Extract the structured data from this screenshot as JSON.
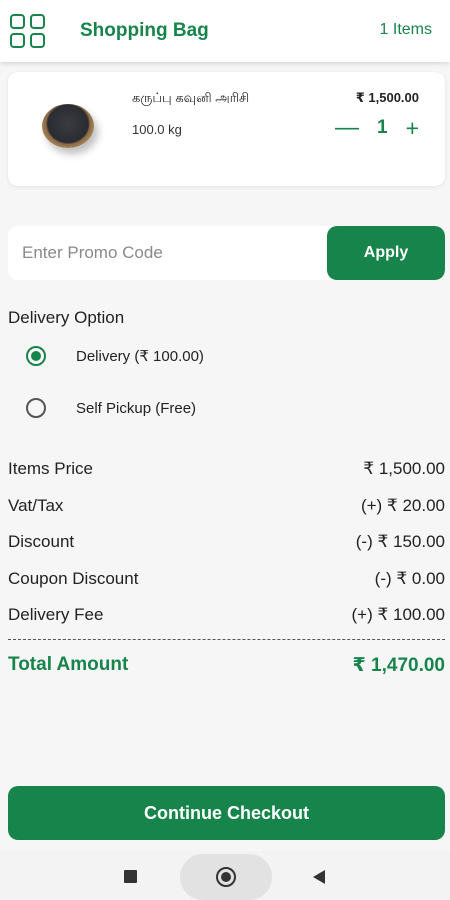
{
  "header": {
    "title": "Shopping Bag",
    "item_count": "1 Items"
  },
  "cart": {
    "items": [
      {
        "name": "கருப்பு கவுனி அரிசி",
        "quantity": "100.0 kg",
        "price": "₹ 1,500.00",
        "count": "1",
        "minus": "—",
        "plus": "+"
      }
    ]
  },
  "promo": {
    "placeholder": "Enter Promo Code",
    "apply_label": "Apply"
  },
  "delivery": {
    "title": "Delivery Option",
    "options": [
      {
        "label": "Delivery  (₹ 100.00)",
        "selected": true
      },
      {
        "label": "Self Pickup  (Free)",
        "selected": false
      }
    ]
  },
  "summary": {
    "rows": [
      {
        "label": "Items Price",
        "value": "₹ 1,500.00"
      },
      {
        "label": "Vat/Tax",
        "value": "(+) ₹ 20.00"
      },
      {
        "label": "Discount",
        "value": "(-) ₹ 150.00"
      },
      {
        "label": "Coupon Discount",
        "value": "(-) ₹ 0.00"
      },
      {
        "label": "Delivery Fee",
        "value": "(+) ₹ 100.00"
      }
    ],
    "total_label": "Total Amount",
    "total_value": "₹ 1,470.00"
  },
  "checkout": {
    "label": "Continue Checkout"
  },
  "colors": {
    "brand": "#17854b",
    "background": "#f6f6f6"
  },
  "icons": {
    "menu": "grid-icon",
    "nav_recent": "square-icon",
    "nav_home": "circle-icon",
    "nav_back": "triangle-back-icon"
  }
}
